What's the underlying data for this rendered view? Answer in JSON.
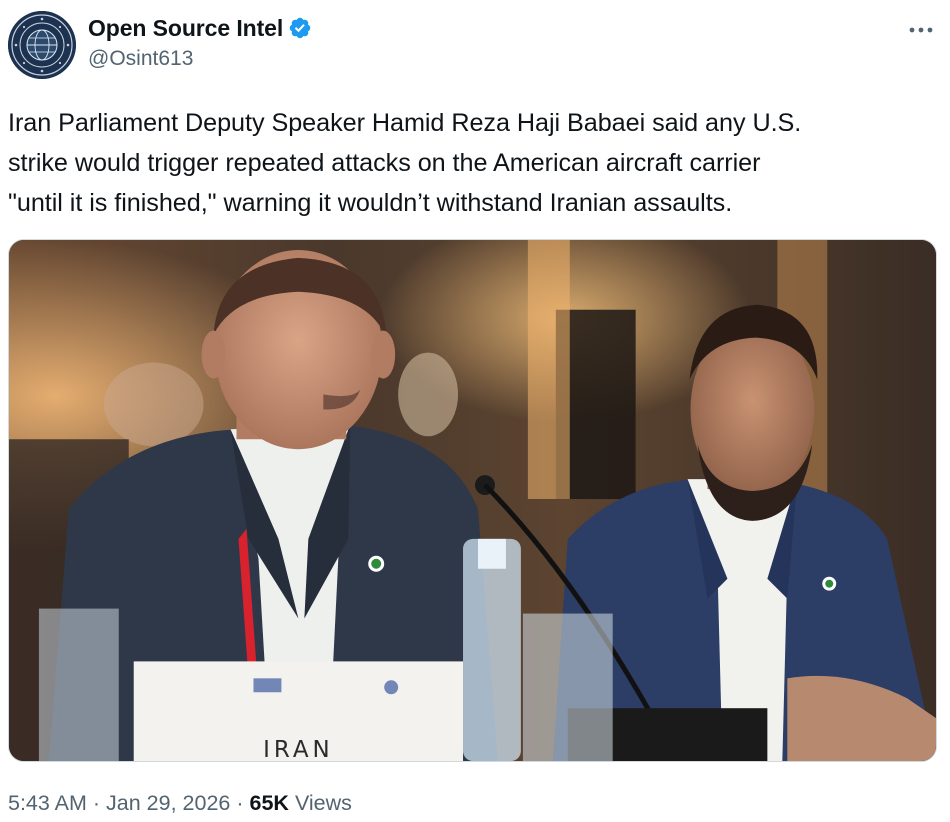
{
  "author": {
    "display_name": "Open Source Intel",
    "handle": "@Osint613",
    "verified": true,
    "verified_color": "#1d9bf0",
    "avatar_icon": "globe-emblem-avatar"
  },
  "menu": {
    "icon": "more-dots-icon"
  },
  "post": {
    "lines": [
      "Iran Parliament Deputy Speaker Hamid Reza Haji Babaei said any U.S.",
      "strike would trigger repeated attacks on the American aircraft carrier",
      "\"until it is finished,\" warning it wouldn’t withstand Iranian assaults."
    ]
  },
  "media": {
    "nameplate_text": "IRAN"
  },
  "meta": {
    "time": "5:43 AM",
    "separator": "·",
    "date": "Jan 29, 2026",
    "views_count": "65K",
    "views_label": "Views"
  },
  "colors": {
    "text_primary": "#0f1419",
    "text_secondary": "#536471",
    "border": "#cfd9de"
  }
}
